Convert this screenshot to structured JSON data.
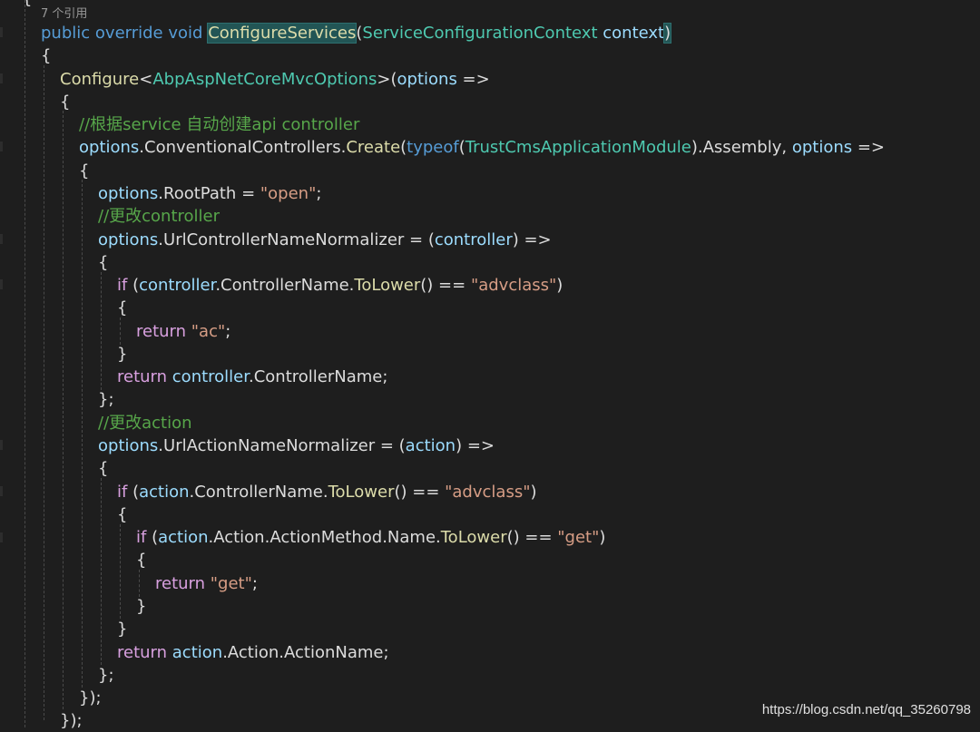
{
  "reference_count": "7 个引用",
  "watermark": "https://blog.csdn.net/qq_35260798",
  "code": {
    "l0": {
      "a": "public",
      "b": "override",
      "c": "void",
      "d": "ConfigureServices",
      "e": "(",
      "f": "ServiceConfigurationContext",
      "g": "context",
      "h": ")"
    },
    "l1": "{",
    "l2": {
      "a": "Configure",
      "b": "<",
      "c": "AbpAspNetCoreMvcOptions",
      "d": ">(",
      "e": "options",
      "f": " =>"
    },
    "l3": "{",
    "l4": "//根据service 自动创建api controller",
    "l5": {
      "a": "options",
      "b": ".",
      "c": "ConventionalControllers",
      "d": ".",
      "e": "Create",
      "f": "(",
      "g": "typeof",
      "h": "(",
      "i": "TrustCmsApplicationModule",
      "j": ").Assembly, ",
      "k": "options",
      "l": " =>"
    },
    "l6": "{",
    "l7": {
      "a": "options",
      "b": ".RootPath = ",
      "c": "\"open\"",
      "d": ";"
    },
    "l8": "//更改controller",
    "l9": {
      "a": "options",
      "b": ".UrlControllerNameNormalizer = (",
      "c": "controller",
      "d": ") =>"
    },
    "l10": "{",
    "l11": {
      "a": "if",
      "b": " (",
      "c": "controller",
      "d": ".ControllerName.",
      "e": "ToLower",
      "f": "() == ",
      "g": "\"advclass\"",
      "h": ")"
    },
    "l12": "{",
    "l13": {
      "a": "return",
      "b": " ",
      "c": "\"ac\"",
      "d": ";"
    },
    "l14": "}",
    "l15": {
      "a": "return",
      "b": " ",
      "c": "controller",
      "d": ".ControllerName;"
    },
    "l16": "};",
    "l17": "//更改action",
    "l18": {
      "a": "options",
      "b": ".UrlActionNameNormalizer = (",
      "c": "action",
      "d": ") =>"
    },
    "l19": "{",
    "l20": {
      "a": "if",
      "b": " (",
      "c": "action",
      "d": ".ControllerName.",
      "e": "ToLower",
      "f": "() == ",
      "g": "\"advclass\"",
      "h": ")"
    },
    "l21": "{",
    "l22": {
      "a": "if",
      "b": " (",
      "c": "action",
      "d": ".Action.ActionMethod.Name.",
      "e": "ToLower",
      "f": "() == ",
      "g": "\"get\"",
      "h": ")"
    },
    "l23": "{",
    "l24": {
      "a": "return",
      "b": " ",
      "c": "\"get\"",
      "d": ";"
    },
    "l25": "}",
    "l26": "}",
    "l27": {
      "a": "return",
      "b": " ",
      "c": "action",
      "d": ".Action.ActionName;"
    },
    "l28": "};",
    "l29": "});",
    "l30": "});"
  }
}
